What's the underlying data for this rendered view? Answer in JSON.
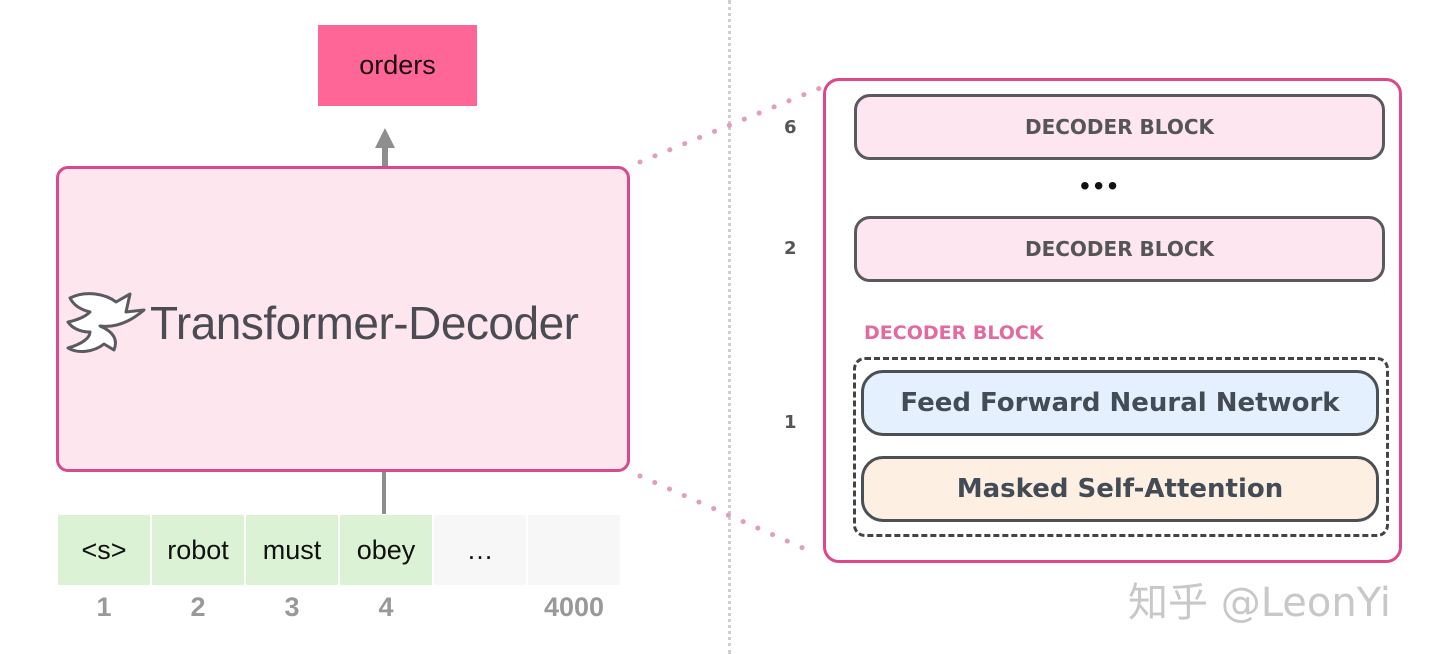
{
  "left_panel": {
    "output_token": "orders",
    "model_title": "Transformer-Decoder",
    "logo_icon": "hugging-face-transformers-logo",
    "tokens": [
      {
        "text": "<s>",
        "position": "1",
        "filled": true
      },
      {
        "text": "robot",
        "position": "2",
        "filled": true
      },
      {
        "text": "must",
        "position": "3",
        "filled": true
      },
      {
        "text": "obey",
        "position": "4",
        "filled": true
      },
      {
        "text": "…",
        "position": "",
        "filled": false
      },
      {
        "text": "",
        "position": "4000",
        "filled": false
      }
    ]
  },
  "right_panel": {
    "layers": [
      {
        "number": "6",
        "label": "DECODER BLOCK"
      },
      {
        "number": "2",
        "label": "DECODER BLOCK"
      }
    ],
    "ellipsis": "•••",
    "expanded_layer": {
      "number": "1",
      "label": "DECODER BLOCK",
      "sublayers": [
        "Feed Forward Neural Network",
        "Masked Self-Attention"
      ]
    }
  },
  "colors": {
    "output_box": "#ff6698",
    "decoder_fill": "#fde6ee",
    "decoder_border": "#d94a8a",
    "token_fill": "#dbf2d4",
    "ffnn_fill": "#e4f0fd",
    "msa_fill": "#fdefe2",
    "accent_label": "#e36a9e"
  },
  "watermark": "知乎 @LeonYi"
}
